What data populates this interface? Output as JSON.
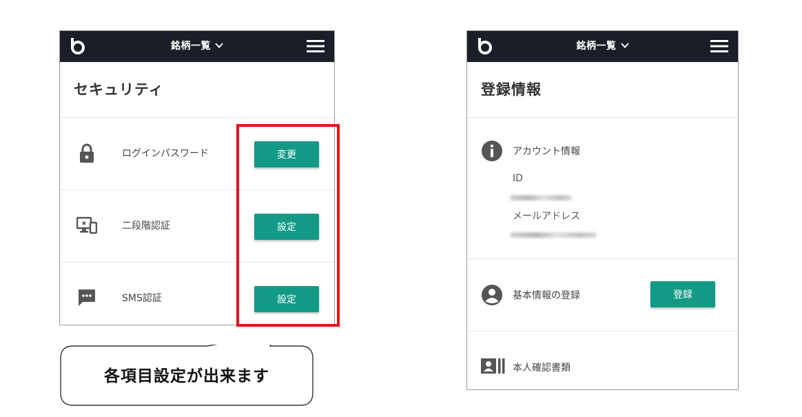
{
  "left_screen": {
    "header": {
      "title": "銘柄一覧"
    },
    "page_title": "セキュリティ",
    "rows": [
      {
        "icon": "lock-icon",
        "label": "ログインパスワード",
        "button": "変更"
      },
      {
        "icon": "two-factor-device-icon",
        "label": "二段階認証",
        "button": "設定"
      },
      {
        "icon": "chat-message-icon",
        "label": "SMS認証",
        "button": "設定"
      }
    ]
  },
  "callout": {
    "text": "各項目設定が出来ます",
    "highlight_color": "#e6121a"
  },
  "right_screen": {
    "header": {
      "title": "銘柄一覧"
    },
    "page_title": "登録情報",
    "account": {
      "icon": "info-icon",
      "label": "アカウント情報",
      "id_label": "ID",
      "email_label": "メールアドレス"
    },
    "basic_info": {
      "icon": "person-icon",
      "label": "基本情報の登録",
      "button": "登録"
    },
    "identity": {
      "icon": "id-card-icon",
      "label": "本人確認書類"
    }
  },
  "colors": {
    "header_bg": "#1b1e27",
    "button_bg": "#139a87",
    "highlight": "#e6121a"
  }
}
